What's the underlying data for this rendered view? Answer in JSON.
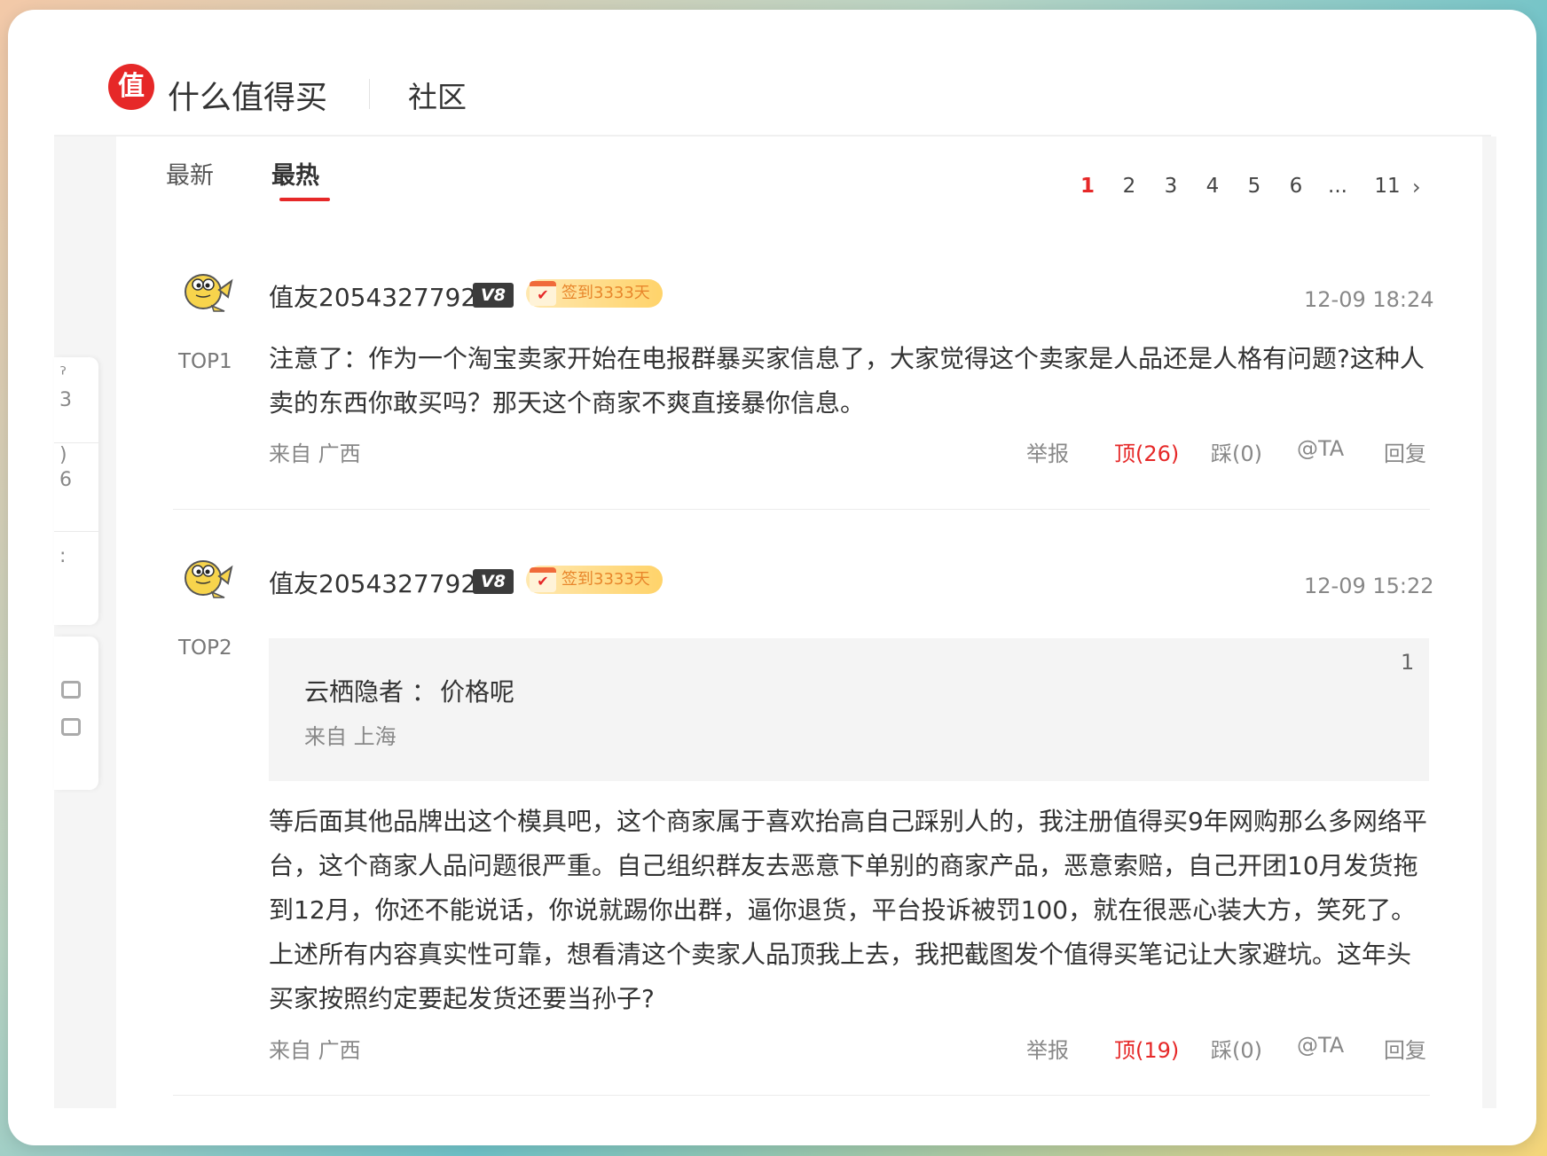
{
  "header": {
    "logo_char": "值",
    "brand": "什么值得买",
    "section": "社区"
  },
  "rail": {
    "a1": "3",
    "a2": "6"
  },
  "tabs": [
    {
      "label": "最新",
      "active": false
    },
    {
      "label": "最热",
      "active": true
    }
  ],
  "pagination": {
    "pages": [
      "1",
      "2",
      "3",
      "4",
      "5",
      "6",
      "...",
      "11"
    ],
    "active": "1",
    "next": "›"
  },
  "comments": [
    {
      "username": "值友2054327792",
      "level": "V8",
      "sign_badge": "签到3333天",
      "time": "12-09 18:24",
      "rank": "TOP1",
      "content": "注意了：作为一个淘宝卖家开始在电报群暴买家信息了，大家觉得这个卖家是人品还是人格有问题?这种人卖的东西你敢买吗？那天这个商家不爽直接暴你信息。",
      "from": "来自  广西",
      "actions": {
        "report": "举报",
        "up": "顶(26)",
        "down": "踩(0)",
        "at": "@TA",
        "reply": "回复"
      }
    },
    {
      "username": "值友2054327792",
      "level": "V8",
      "sign_badge": "签到3333天",
      "time": "12-09 15:22",
      "rank": "TOP2",
      "quote": {
        "floor": "1",
        "user": "云栖隐者 ：",
        "text": "价格呢",
        "from": "来自  上海"
      },
      "content": "等后面其他品牌出这个模具吧，这个商家属于喜欢抬高自己踩别人的，我注册值得买9年网购那么多网络平台，这个商家人品问题很严重。自己组织群友去恶意下单别的商家产品，恶意索赔，自己开团10月发货拖到12月，你还不能说话，你说就踢你出群，逼你退货，平台投诉被罚100，就在很恶心装大方，笑死了。上述所有内容真实性可靠，想看清这个卖家人品顶我上去，我把截图发个值得买笔记让大家避坑。这年头买家按照约定要起发货还要当孙子?",
      "from": "来自  广西",
      "actions": {
        "report": "举报",
        "up": "顶(19)",
        "down": "踩(0)",
        "at": "@TA",
        "reply": "回复"
      }
    }
  ],
  "colors": {
    "accent": "#e62828",
    "badge": "#e8862b"
  }
}
